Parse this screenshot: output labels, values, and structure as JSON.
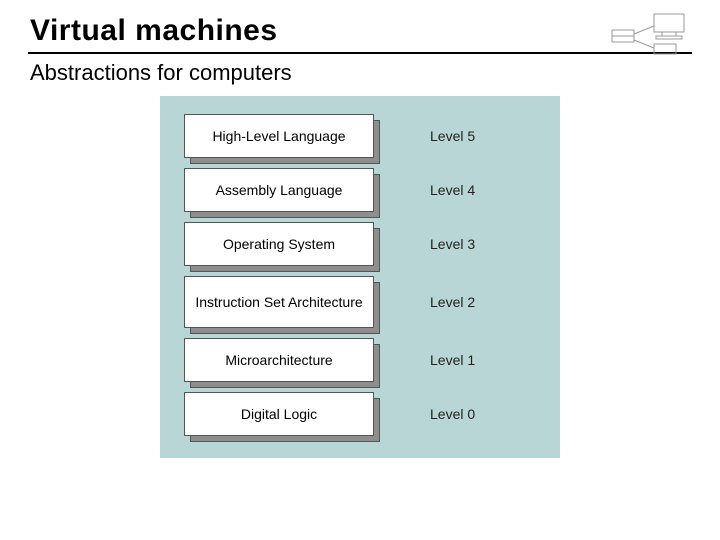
{
  "header": {
    "title": "Virtual machines",
    "subtitle": "Abstractions for computers"
  },
  "diagram": {
    "layers": [
      {
        "name": "High-Level Language",
        "level": "Level 5"
      },
      {
        "name": "Assembly Language",
        "level": "Level 4"
      },
      {
        "name": "Operating System",
        "level": "Level 3"
      },
      {
        "name": "Instruction Set Architecture",
        "level": "Level 2"
      },
      {
        "name": "Microarchitecture",
        "level": "Level 1"
      },
      {
        "name": "Digital Logic",
        "level": "Level 0"
      }
    ]
  }
}
